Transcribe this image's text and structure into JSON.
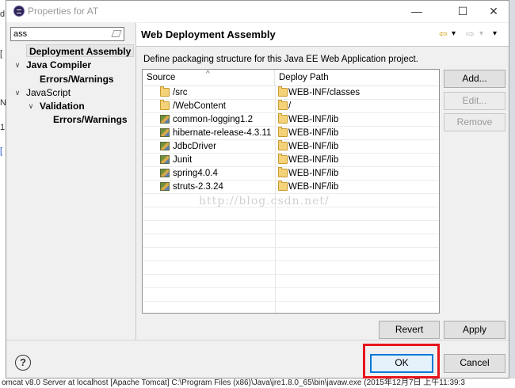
{
  "window": {
    "title": "Properties for AT",
    "minimize_glyph": "—",
    "maximize_glyph": "☐",
    "close_glyph": "✕"
  },
  "filter": {
    "value": "ass"
  },
  "tree": [
    {
      "label": "Deployment Assembly",
      "selected": true
    },
    {
      "label": "Java Compiler",
      "twisty": "∨"
    },
    {
      "label": "Errors/Warnings"
    },
    {
      "label": "JavaScript",
      "twisty": "∨"
    },
    {
      "label": "Validation",
      "twisty": "∨"
    },
    {
      "label": "Errors/Warnings"
    }
  ],
  "page": {
    "title": "Web Deployment Assembly",
    "description": "Define packaging structure for this Java EE Web Application project.",
    "nav": {
      "back_glyph": "⇦",
      "forward_glyph": "⇨",
      "menu_glyph": "▾"
    }
  },
  "table": {
    "headers": {
      "source": "Source",
      "deploy_path": "Deploy Path"
    },
    "rows": [
      {
        "source": "/src",
        "source_icon": "folder-icon",
        "deploy_path": "WEB-INF/classes"
      },
      {
        "source": "/WebContent",
        "source_icon": "folder-icon",
        "deploy_path": "/"
      },
      {
        "source": "common-logging1.2",
        "source_icon": "library-icon",
        "deploy_path": "WEB-INF/lib"
      },
      {
        "source": "hibernate-release-4.3.11",
        "source_icon": "library-icon",
        "deploy_path": "WEB-INF/lib"
      },
      {
        "source": "JdbcDriver",
        "source_icon": "library-icon",
        "deploy_path": "WEB-INF/lib"
      },
      {
        "source": "Junit",
        "source_icon": "library-icon",
        "deploy_path": "WEB-INF/lib"
      },
      {
        "source": "spring4.0.4",
        "source_icon": "library-icon",
        "deploy_path": "WEB-INF/lib"
      },
      {
        "source": "struts-2.3.24",
        "source_icon": "library-icon",
        "deploy_path": "WEB-INF/lib"
      }
    ]
  },
  "buttons": {
    "add": "Add...",
    "edit": "Edit...",
    "remove": "Remove",
    "revert": "Revert",
    "apply": "Apply",
    "ok": "OK",
    "cancel": "Cancel",
    "help": "?"
  },
  "watermark": "http://blog.csdn.net/",
  "background": {
    "status_text": "omcat v8.0 Server at localhost [Apache Tomcat] C:\\Program Files (x86)\\Java\\jre1.8.0_65\\bin\\javaw.exe (2015年12月7日 上午11:39:3",
    "glyph_a": "d",
    "glyph_b": "[",
    "glyph_c": "N",
    "glyph_d": "1",
    "glyph_e": "["
  },
  "colors": {
    "highlight": "#e8141a",
    "accent": "#0078d7"
  }
}
